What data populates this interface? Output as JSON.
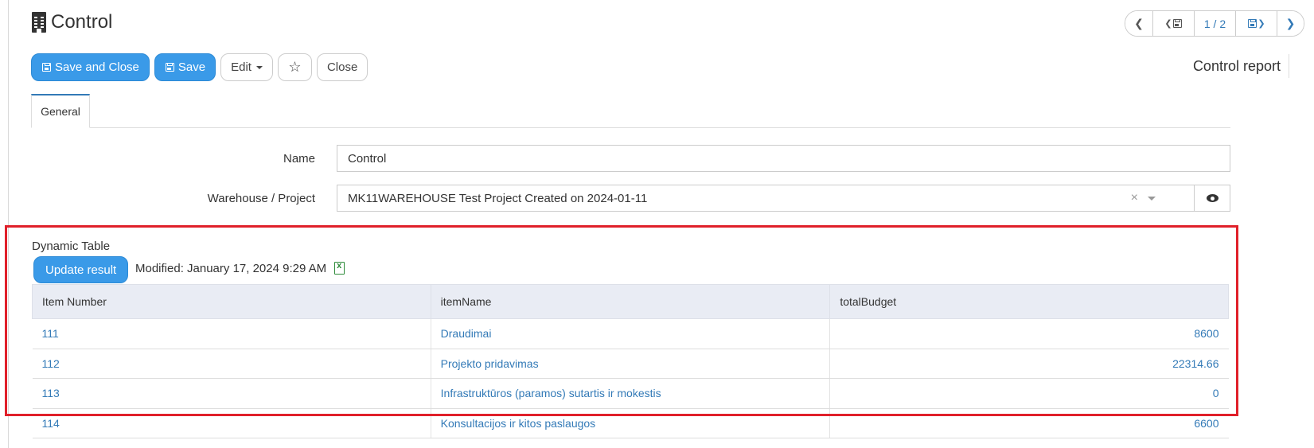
{
  "header": {
    "title": "Control",
    "pager": {
      "count": "1 / 2"
    },
    "report_link": "Control report"
  },
  "toolbar": {
    "save_close": "Save and Close",
    "save": "Save",
    "edit": "Edit",
    "close": "Close"
  },
  "tabs": [
    {
      "label": "General",
      "active": true
    }
  ],
  "form": {
    "name_label": "Name",
    "name_value": "Control",
    "warehouse_label": "Warehouse / Project",
    "warehouse_value": "MK11WAREHOUSE Test Project Created on 2024-01-11",
    "clear_glyph": "×"
  },
  "dynamic_table": {
    "title": "Dynamic Table",
    "update_button": "Update result",
    "modified": "Modified: January 17, 2024 9:29 AM",
    "columns": [
      "Item Number",
      "itemName",
      "totalBudget"
    ],
    "rows": [
      {
        "number": "111",
        "name": "Draudimai",
        "budget": "8600"
      },
      {
        "number": "112",
        "name": "Projekto pridavimas",
        "budget": "22314.66"
      },
      {
        "number": "113",
        "name": "Infrastruktūros (paramos) sutartis ir mokestis",
        "budget": "0"
      },
      {
        "number": "114",
        "name": "Konsultacijos ir kitos paslaugos",
        "budget": "6600"
      }
    ]
  },
  "colors": {
    "primary": "#3a9ae8",
    "link": "#337ab7",
    "highlight_frame": "#e0202a",
    "table_header_bg": "#e9ecf4"
  }
}
